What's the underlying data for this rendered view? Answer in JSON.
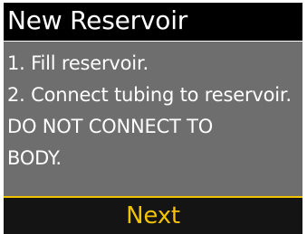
{
  "header": {
    "title": "New Reservoir"
  },
  "instructions": {
    "lines": [
      "1. Fill reservoir.",
      "2. Connect tubing to reservoir.",
      "DO NOT CONNECT TO",
      "BODY."
    ]
  },
  "soft_keys": {
    "next_label": "Next"
  },
  "colors": {
    "title_bar": "#000000",
    "content_bg": "#6e6e6e",
    "accent": "#f2c300",
    "soft_key_bg": "#141414",
    "text": "#ffffff"
  }
}
